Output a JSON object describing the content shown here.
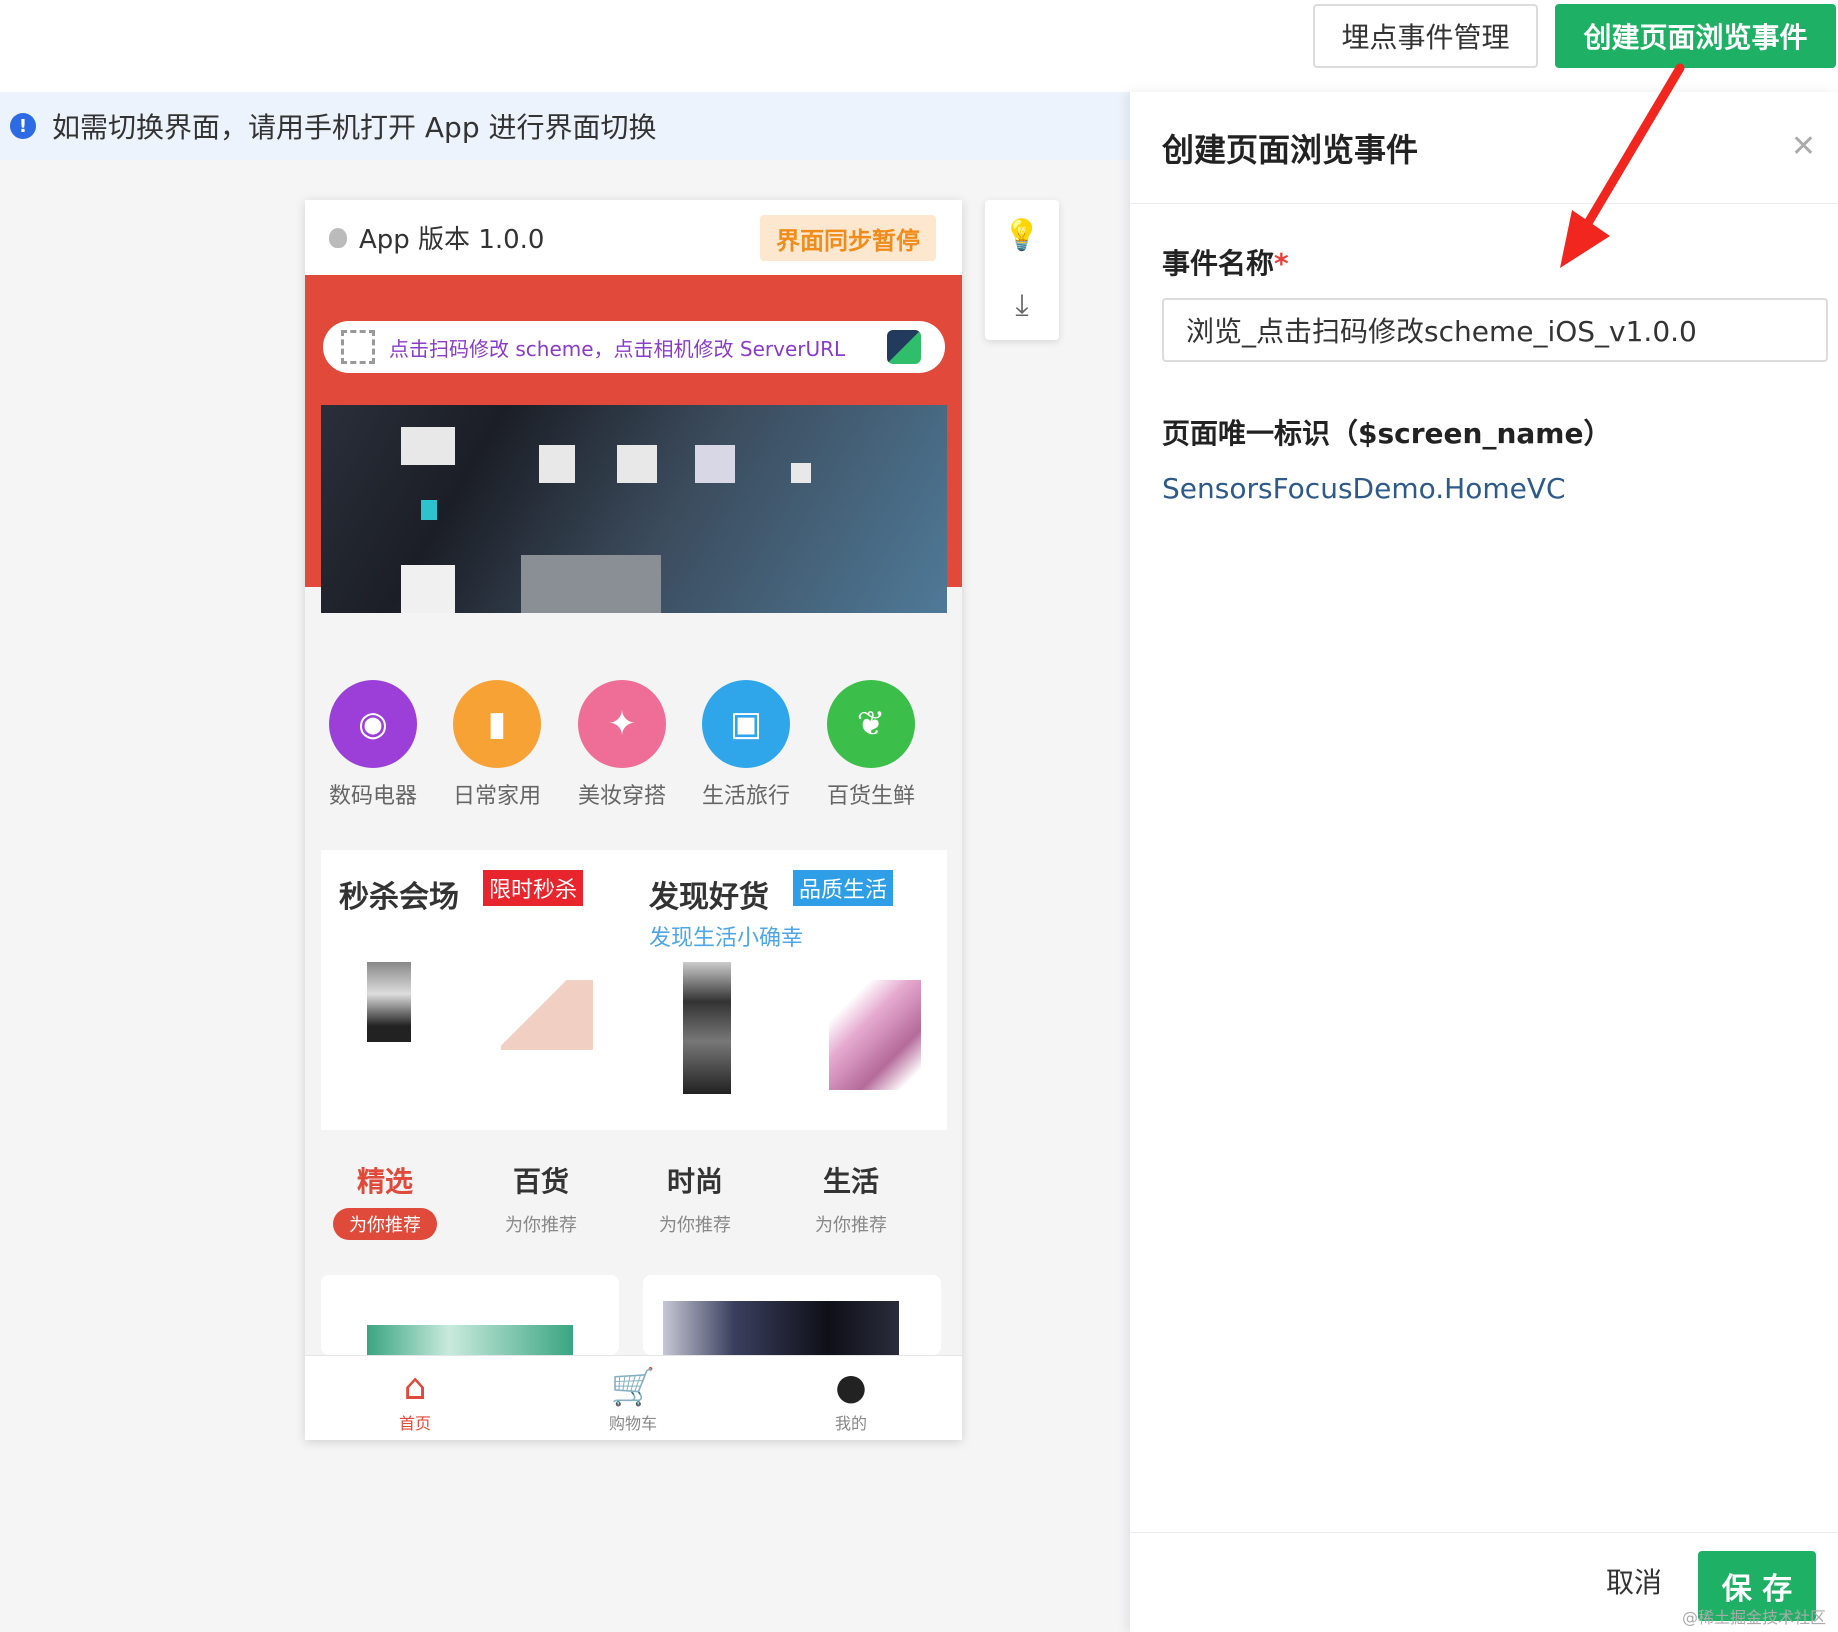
{
  "toolbar": {
    "manage_label": "埋点事件管理",
    "create_label": "创建页面浏览事件"
  },
  "notice": {
    "icon": "info-icon",
    "text": "如需切换界面，请用手机打开 App 进行界面切换"
  },
  "phone": {
    "version": "App 版本 1.0.0",
    "sync_badge": "界面同步暂停",
    "scan_text": "点击扫码修改 scheme，点击相机修改 ServerURL",
    "categories": [
      {
        "label": "数码电器",
        "color": "#9b3fd8",
        "icon": "camera-icon"
      },
      {
        "label": "日常家用",
        "color": "#f7a234",
        "icon": "tissue-icon"
      },
      {
        "label": "美妆穿搭",
        "color": "#ef6e97",
        "icon": "cosmetics-icon"
      },
      {
        "label": "生活旅行",
        "color": "#2fa5ea",
        "icon": "luggage-icon"
      },
      {
        "label": "百货生鲜",
        "color": "#3bbf4a",
        "icon": "fruit-icon"
      }
    ],
    "promo": {
      "left_title": "秒杀会场",
      "left_tag": "限时秒杀",
      "right_title": "发现好货",
      "right_tag": "品质生活",
      "right_sub": "发现生活小确幸"
    },
    "tabs": [
      {
        "title": "精选",
        "sub": "为你推荐"
      },
      {
        "title": "百货",
        "sub": "为你推荐"
      },
      {
        "title": "时尚",
        "sub": "为你推荐"
      },
      {
        "title": "生活",
        "sub": "为你推荐"
      }
    ],
    "nav": [
      {
        "label": "首页",
        "icon": "home-icon"
      },
      {
        "label": "购物车",
        "icon": "cart-icon"
      },
      {
        "label": "我的",
        "icon": "user-icon"
      }
    ]
  },
  "drawer": {
    "title": "创建页面浏览事件",
    "field_label": "事件名称",
    "required_mark": "*",
    "event_name_value": "浏览_点击扫码修改scheme_iOS_v1.0.0",
    "screen_label": "页面唯一标识（$screen_name）",
    "screen_value": "SensorsFocusDemo.HomeVC",
    "cancel_label": "取消",
    "save_label": "保 存"
  },
  "watermark": "@稀土掘金技术社区",
  "colors": {
    "brand_green": "#1eb065",
    "app_red": "#e14a3a",
    "sync_orange": "#f08c1c"
  }
}
